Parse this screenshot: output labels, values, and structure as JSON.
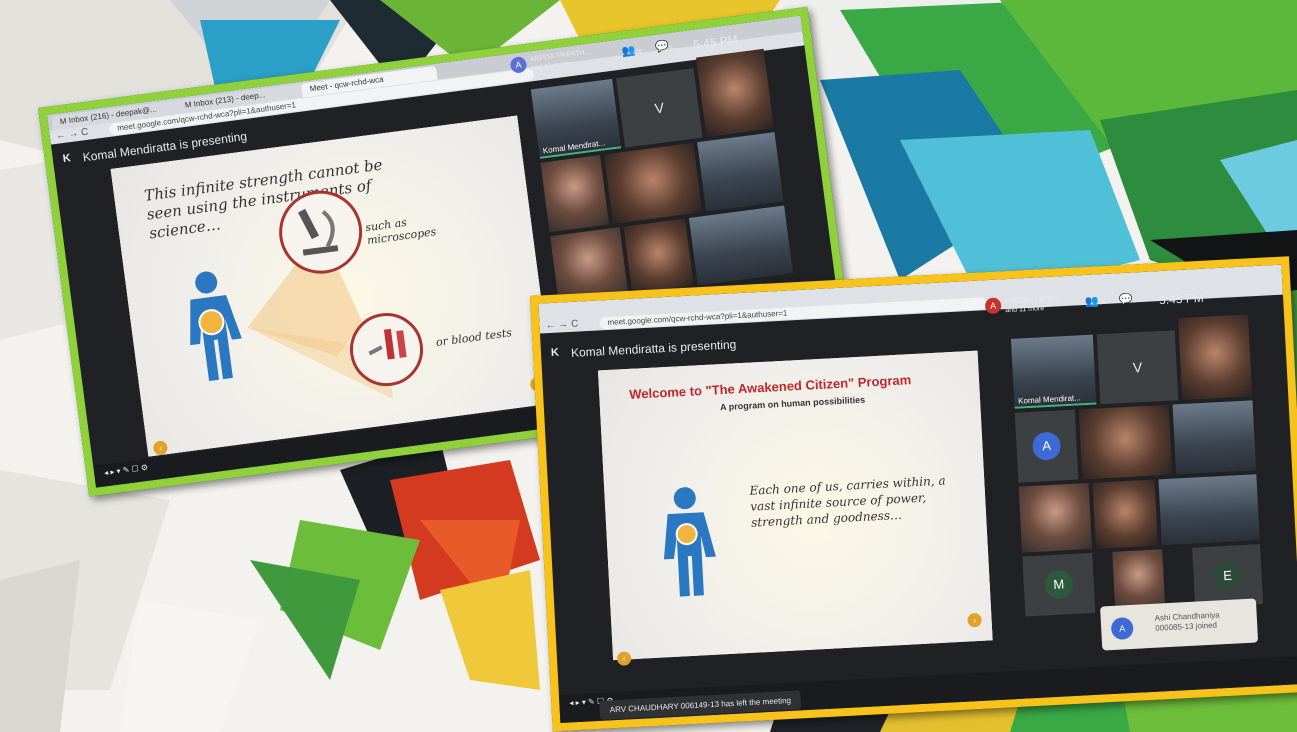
{
  "colors": {
    "frame1": "#8ed13b",
    "frame2": "#f7c21a",
    "meet_dark": "#202124",
    "speaker_green": "#3fb67a",
    "title_red": "#c0282d"
  },
  "photo1": {
    "tabs": [
      "M  Inbox (216) - deepak@...",
      "M  Inbox (213) - deep...",
      "Meet - qcw-rchd-wca"
    ],
    "url": "meet.google.com/qcw-rchd-wca?pli=1&authuser=1",
    "presenting_initial": "K",
    "presenting": "Komal Mendiratta is presenting",
    "participants_avatar": "A",
    "participants": "ARPITA TRIPATH...",
    "participants_more": "and 11 more",
    "time": "5:45 PM",
    "people_badge": "26",
    "chat_badge": "3",
    "slide": {
      "text": "This infinite strength cannot be seen using the instruments of science…",
      "caption1": "such as microscopes",
      "caption2": "or blood tests"
    },
    "tiles": [
      {
        "letter": ""
      },
      {
        "letter": "V"
      },
      {
        "letter": ""
      },
      {
        "letter": ""
      },
      {
        "letter": ""
      },
      {
        "letter": ""
      },
      {
        "letter": ""
      },
      {
        "letter": ""
      },
      {
        "letter": ""
      }
    ],
    "speaker_name": "Komal Mendirat..."
  },
  "photo2": {
    "url": "meet.google.com/qcw-rchd-wca?pli=1&authuser=1",
    "presenting_initial": "K",
    "presenting": "Komal Mendiratta is presenting",
    "participants_avatar": "A",
    "participants": "AREEBA FATIMA...",
    "participants_more": "and 11 more",
    "time": "5:45 PM",
    "people_badge": "26",
    "chat_badge": "3",
    "slide": {
      "title": "Welcome to \"The Awakened Citizen\" Program",
      "subtitle": "A program on human possibilities",
      "text": "Each one of us, carries within, a vast infinite source of power, strength and goodness…"
    },
    "speaker_name": "Komal Mendirat...",
    "tile_letters": [
      "V",
      "A",
      "M",
      "E"
    ],
    "left_toast": "ARV CHAUDHARY 006149-13 has left the meeting",
    "join_avatar": "A",
    "join_text": "Ashi Chandhaniya 000085-13 joined"
  }
}
